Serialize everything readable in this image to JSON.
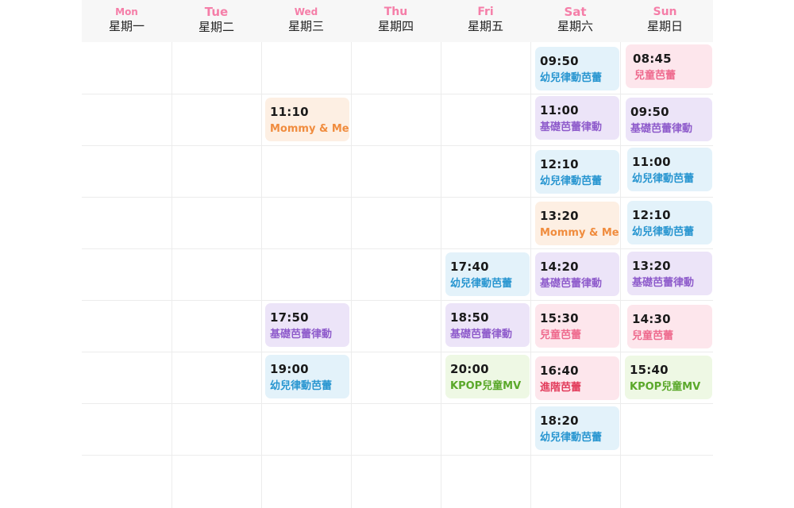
{
  "days": [
    {
      "en": "Mon",
      "zh": "星期一"
    },
    {
      "en": "Tue",
      "zh": "星期二"
    },
    {
      "en": "Wed",
      "zh": "星期三"
    },
    {
      "en": "Thu",
      "zh": "星期四"
    },
    {
      "en": "Fri",
      "zh": "星期五"
    },
    {
      "en": "Sat",
      "zh": "星期六"
    },
    {
      "en": "Sun",
      "zh": "星期日"
    }
  ],
  "classes": {
    "wed": [
      {
        "time": "11:10",
        "name": "Mommy & Me"
      },
      {
        "time": "17:50",
        "name": "基礎芭蕾律動"
      },
      {
        "time": "19:00",
        "name": "幼兒律動芭蕾"
      }
    ],
    "fri": [
      {
        "time": "17:40",
        "name": "幼兒律動芭蕾"
      },
      {
        "time": "18:50",
        "name": "基礎芭蕾律動"
      },
      {
        "time": "20:00",
        "name": "KPOP兒童MV"
      }
    ],
    "sat": [
      {
        "time": "09:50",
        "name": "幼兒律動芭蕾"
      },
      {
        "time": "11:00",
        "name": "基礎芭蕾律動"
      },
      {
        "time": "12:10",
        "name": "幼兒律動芭蕾"
      },
      {
        "time": "13:20",
        "name": "Mommy & Me"
      },
      {
        "time": "14:20",
        "name": "基礎芭蕾律動"
      },
      {
        "time": "15:30",
        "name": "兒童芭蕾"
      },
      {
        "time": "16:40",
        "name": "進階芭蕾"
      },
      {
        "time": "18:20",
        "name": "幼兒律動芭蕾"
      }
    ],
    "sun": [
      {
        "time": "08:45",
        "name": "兒童芭蕾"
      },
      {
        "time": "09:50",
        "name": "基礎芭蕾律動"
      },
      {
        "time": "11:00",
        "name": "幼兒律動芭蕾"
      },
      {
        "time": "12:10",
        "name": "幼兒律動芭蕾"
      },
      {
        "time": "13:20",
        "name": "基礎芭蕾律動"
      },
      {
        "time": "14:30",
        "name": "兒童芭蕾"
      },
      {
        "time": "15:40",
        "name": "KPOP兒童MV"
      }
    ]
  },
  "colors": {
    "day_en": "#f57ea8",
    "blue": "#2795d0",
    "purple": "#8e5bcb",
    "peach": "#f08c3e",
    "pink": "#ee6a8e",
    "deep_pink": "#e23a5a",
    "green": "#5aa82a"
  }
}
